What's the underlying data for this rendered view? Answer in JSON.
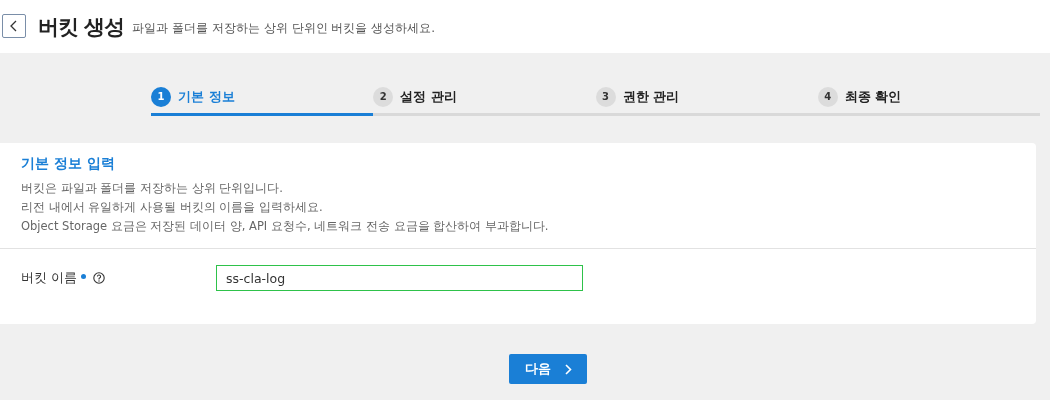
{
  "header": {
    "title": "버킷 생성",
    "subtitle": "파일과 폴더를 저장하는 상위 단위인 버킷을 생성하세요."
  },
  "steps": [
    {
      "number": "1",
      "label": "기본 정보",
      "selected": true
    },
    {
      "number": "2",
      "label": "설정 관리",
      "selected": false
    },
    {
      "number": "3",
      "label": "권한 관리",
      "selected": false
    },
    {
      "number": "4",
      "label": "최종 확인",
      "selected": false
    }
  ],
  "section": {
    "title": "기본 정보 입력",
    "descriptions": [
      "버킷은 파일과 폴더를 저장하는 상위 단위입니다.",
      "리전 내에서 유일하게 사용될 버킷의 이름을 입력하세요.",
      "Object Storage 요금은 저장된 데이터 양, API 요청수, 네트워크 전송 요금을 합산하여 부과합니다."
    ]
  },
  "fields": [
    {
      "label": "버킷 이름",
      "required": true,
      "value": "ss-cla-log",
      "valid": true
    }
  ],
  "next_button": {
    "label": "다음"
  }
}
